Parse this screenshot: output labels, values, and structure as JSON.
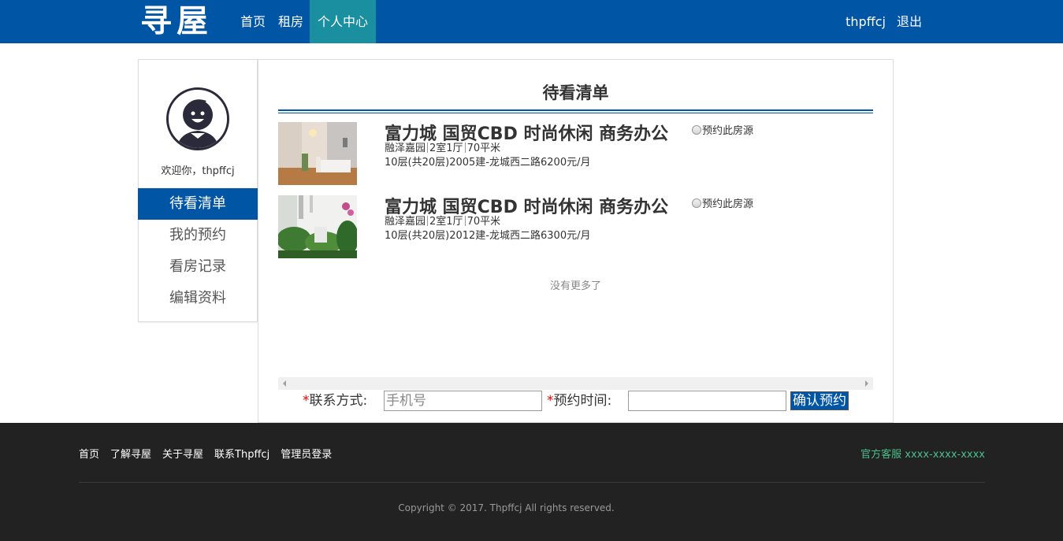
{
  "header": {
    "logo": "寻屋",
    "nav": [
      "首页",
      "租房",
      "个人中心"
    ],
    "active_nav": "个人中心",
    "username": "thpffcj",
    "logout": "退出"
  },
  "sidebar": {
    "welcome": "欢迎你，thpffcj",
    "items": [
      {
        "label": "待看清单",
        "active": true
      },
      {
        "label": "我的预约",
        "active": false
      },
      {
        "label": "看房记录",
        "active": false
      },
      {
        "label": "编辑资料",
        "active": false
      }
    ]
  },
  "main": {
    "title": "待看清单",
    "listings": [
      {
        "title": "富力城 国贸CBD 时尚休闲 商务办公",
        "community": "融泽嘉园",
        "layout": "2室1厅",
        "area": "70平米",
        "detail": "10层(共20层)2005建-龙城西二路6200元/月",
        "reserve_label": "预约此房源"
      },
      {
        "title": "富力城 国贸CBD 时尚休闲 商务办公",
        "community": "融泽嘉园",
        "layout": "2室1厅",
        "area": "70平米",
        "detail": "10层(共20层)2012建-龙城西二路6300元/月",
        "reserve_label": "预约此房源"
      }
    ],
    "no_more": "没有更多了"
  },
  "form": {
    "required_mark": "*",
    "contact_label": "联系方式:",
    "contact_placeholder": "手机号",
    "contact_value": "",
    "time_label": "预约时间:",
    "time_value": "",
    "confirm": "确认预约"
  },
  "footer": {
    "links": [
      "首页",
      "了解寻屋",
      "关于寻屋",
      "联系Thpffcj",
      "管理员登录"
    ],
    "service": "官方客服 xxxx-xxxx-xxxx",
    "copyright": "Copyright © 2017. Thpffcj All rights reserved."
  },
  "colors": {
    "brand_blue": "#0055a5",
    "nav_active": "#1a8fa0",
    "footer_bg": "#222222",
    "service_green": "#4bbf8a",
    "required_red": "#ee0000"
  }
}
